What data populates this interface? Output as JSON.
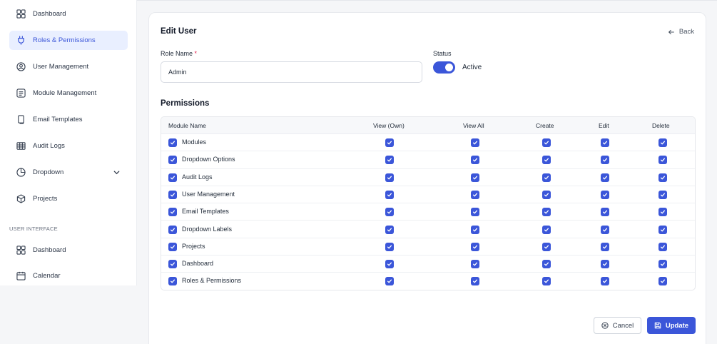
{
  "sidebar": {
    "items": [
      {
        "label": "Dashboard",
        "icon": "grid-icon"
      },
      {
        "label": "Roles & Permissions",
        "icon": "plug-icon",
        "active": true
      },
      {
        "label": "User Management",
        "icon": "user-circle-icon"
      },
      {
        "label": "Module Management",
        "icon": "list-box-icon"
      },
      {
        "label": "Email Templates",
        "icon": "copy-icon"
      },
      {
        "label": "Audit Logs",
        "icon": "table-icon"
      },
      {
        "label": "Dropdown",
        "icon": "pie-chart-icon"
      },
      {
        "label": "Projects",
        "icon": "cube-icon"
      }
    ],
    "section_label": "USER INTERFACE",
    "ui_items": [
      {
        "label": "Dashboard",
        "icon": "grid-icon"
      },
      {
        "label": "Calendar",
        "icon": "calendar-icon"
      }
    ]
  },
  "form": {
    "title": "Edit User",
    "back_label": "Back",
    "role_label": "Role Name",
    "required_mark": "*",
    "role_value": "Admin",
    "status_label": "Status",
    "status_value": "Active",
    "status_on": true
  },
  "permissions": {
    "title": "Permissions",
    "columns": [
      "Module Name",
      "View (Own)",
      "View All",
      "Create",
      "Edit",
      "Delete"
    ],
    "rows": [
      {
        "name": "Modules",
        "checked": [
          true,
          true,
          true,
          true,
          true,
          true
        ]
      },
      {
        "name": "Dropdown Options",
        "checked": [
          true,
          true,
          true,
          true,
          true,
          true
        ]
      },
      {
        "name": "Audit Logs",
        "checked": [
          true,
          true,
          true,
          true,
          true,
          true
        ]
      },
      {
        "name": "User Management",
        "checked": [
          true,
          true,
          true,
          true,
          true,
          true
        ]
      },
      {
        "name": "Email Templates",
        "checked": [
          true,
          true,
          true,
          true,
          true,
          true
        ]
      },
      {
        "name": "Dropdown Labels",
        "checked": [
          true,
          true,
          true,
          true,
          true,
          true
        ]
      },
      {
        "name": "Projects",
        "checked": [
          true,
          true,
          true,
          true,
          true,
          true
        ]
      },
      {
        "name": "Dashboard",
        "checked": [
          true,
          true,
          true,
          true,
          true,
          true
        ]
      },
      {
        "name": "Roles & Permissions",
        "checked": [
          true,
          true,
          true,
          true,
          true,
          true
        ]
      }
    ]
  },
  "actions": {
    "cancel_label": "Cancel",
    "update_label": "Update"
  },
  "colors": {
    "accent": "#3b56d9",
    "active_bg": "#e9efff"
  }
}
